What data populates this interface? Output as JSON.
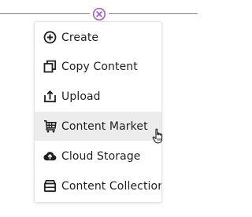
{
  "menu": {
    "items": [
      {
        "label": "Create",
        "icon": "plus-circle-icon"
      },
      {
        "label": "Copy Content",
        "icon": "copy-icon"
      },
      {
        "label": "Upload",
        "icon": "upload-icon"
      },
      {
        "label": "Content Market",
        "icon": "cart-icon"
      },
      {
        "label": "Cloud Storage",
        "icon": "cloud-upload-icon"
      },
      {
        "label": "Content Collection",
        "icon": "archive-icon"
      }
    ],
    "hovered_item": "Content Market"
  },
  "colors": {
    "accent": "#a566c8",
    "hover_background": "#ececec",
    "icon": "#1f1f1f"
  }
}
